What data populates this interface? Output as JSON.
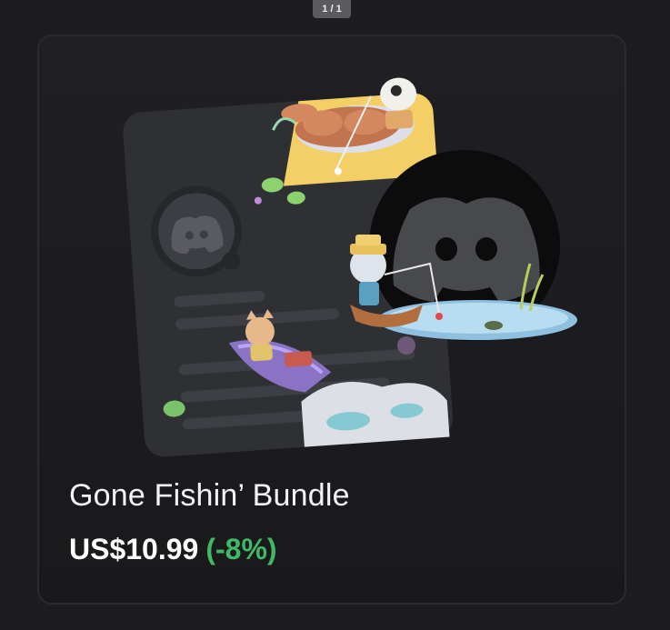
{
  "pager": {
    "text": "1 / 1"
  },
  "product": {
    "title": "Gone Fishin’ Bundle",
    "price": "US$10.99",
    "discount": "(-8%)"
  },
  "colors": {
    "background": "#1c1c21",
    "card": "#1e1e22",
    "discount": "#3fb867",
    "text": "#f2f3f5"
  },
  "icons": {
    "brand": "discord-logo-icon"
  }
}
